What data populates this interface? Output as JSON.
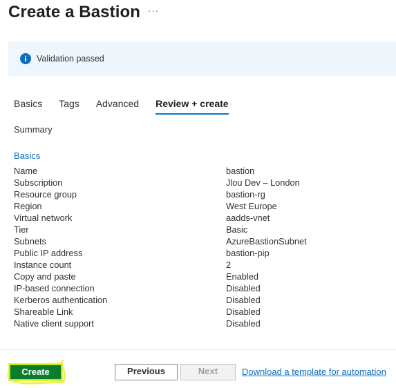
{
  "header": {
    "title": "Create a Bastion",
    "more_label": "···"
  },
  "banner": {
    "text": "Validation passed",
    "icon": "info-icon",
    "color": "#0f6cbd"
  },
  "tabs": [
    {
      "label": "Basics",
      "active": false
    },
    {
      "label": "Tags",
      "active": false
    },
    {
      "label": "Advanced",
      "active": false
    },
    {
      "label": "Review + create",
      "active": true
    }
  ],
  "summary": {
    "heading": "Summary",
    "section_title": "Basics",
    "rows": [
      {
        "key": "Name",
        "value": "bastion"
      },
      {
        "key": "Subscription",
        "value": "Jlou Dev – London"
      },
      {
        "key": "Resource group",
        "value": "bastion-rg"
      },
      {
        "key": "Region",
        "value": "West Europe"
      },
      {
        "key": "Virtual network",
        "value": "aadds-vnet"
      },
      {
        "key": "Tier",
        "value": "Basic"
      },
      {
        "key": "Subnets",
        "value": "AzureBastionSubnet"
      },
      {
        "key": "Public IP address",
        "value": "bastion-pip"
      },
      {
        "key": "Instance count",
        "value": "2"
      },
      {
        "key": "Copy and paste",
        "value": "Enabled"
      },
      {
        "key": "IP-based connection",
        "value": "Disabled"
      },
      {
        "key": "Kerberos authentication",
        "value": "Disabled"
      },
      {
        "key": "Shareable Link",
        "value": "Disabled"
      },
      {
        "key": "Native client support",
        "value": "Disabled"
      }
    ]
  },
  "footer": {
    "create_label": "Create",
    "previous_label": "Previous",
    "next_label": "Next",
    "template_link": "Download a template for automation"
  },
  "colors": {
    "accent": "#0078d4",
    "link": "#0f6cbd",
    "create_button": "#0a7d2c",
    "highlight": "#d8ea1a"
  }
}
